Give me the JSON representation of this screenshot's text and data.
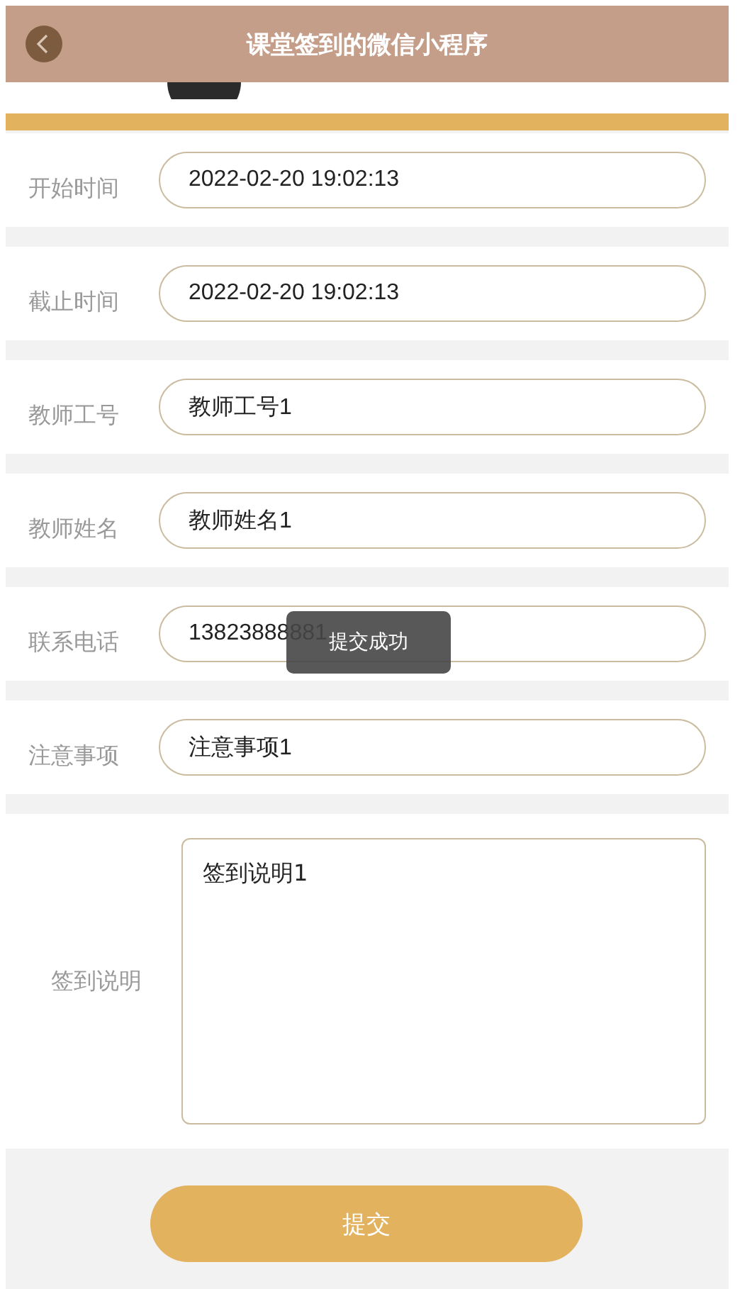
{
  "header": {
    "title": "课堂签到的微信小程序"
  },
  "form": {
    "fields": [
      {
        "kind": "input",
        "label": "开始时间",
        "value": "2022-02-20 19:02:13"
      },
      {
        "kind": "input",
        "label": "截止时间",
        "value": "2022-02-20 19:02:13"
      },
      {
        "kind": "input",
        "label": "教师工号",
        "value": "教师工号1"
      },
      {
        "kind": "input",
        "label": "教师姓名",
        "value": "教师姓名1"
      },
      {
        "kind": "input",
        "label": "联系电话",
        "value": "13823888881"
      },
      {
        "kind": "input",
        "label": "注意事项",
        "value": "注意事项1"
      },
      {
        "kind": "textarea",
        "label": "签到说明",
        "value": "签到说明1"
      }
    ],
    "submit": "提交"
  },
  "toast": {
    "text": "提交成功"
  }
}
